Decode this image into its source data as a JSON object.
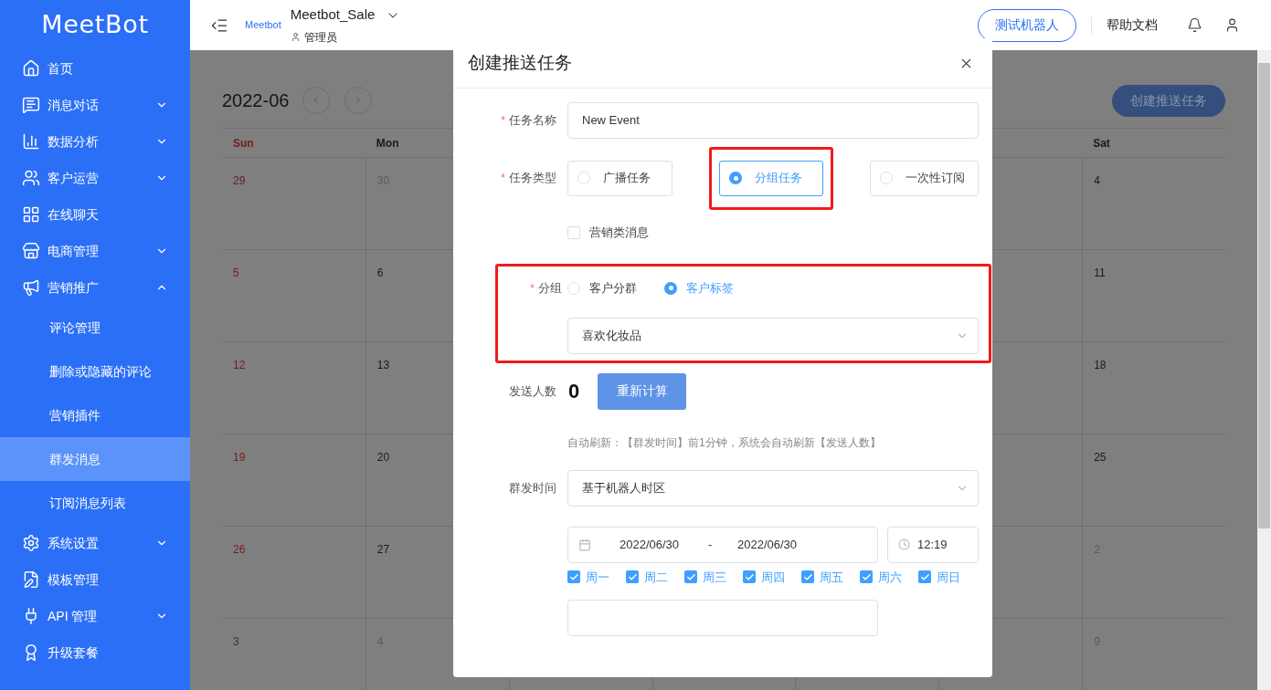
{
  "brand": "MeetBot",
  "sidebar": {
    "items": [
      {
        "label": "首页",
        "expandable": false,
        "expanded": false,
        "selected": false
      },
      {
        "label": "消息对话",
        "expandable": true,
        "expanded": false,
        "selected": false
      },
      {
        "label": "数据分析",
        "expandable": true,
        "expanded": false,
        "selected": false
      },
      {
        "label": "客户运营",
        "expandable": true,
        "expanded": false,
        "selected": false
      },
      {
        "label": "在线聊天",
        "expandable": false,
        "expanded": false,
        "selected": false
      },
      {
        "label": "电商管理",
        "expandable": true,
        "expanded": false,
        "selected": false
      },
      {
        "label": "营销推广",
        "expandable": true,
        "expanded": true,
        "selected": false,
        "children": [
          {
            "label": "评论管理",
            "selected": false
          },
          {
            "label": "删除或隐藏的评论",
            "selected": false
          },
          {
            "label": "营销插件",
            "selected": false
          },
          {
            "label": "群发消息",
            "selected": true
          },
          {
            "label": "订阅消息列表",
            "selected": false
          }
        ]
      },
      {
        "label": "系统设置",
        "expandable": true,
        "expanded": false,
        "selected": false
      },
      {
        "label": "模板管理",
        "expandable": false,
        "expanded": false,
        "selected": false
      },
      {
        "label": "API 管理",
        "expandable": true,
        "expanded": false,
        "selected": false
      },
      {
        "label": "升级套餐",
        "expandable": false,
        "expanded": false,
        "selected": false
      }
    ]
  },
  "header": {
    "logo": "Meetbot",
    "bot_name": "Meetbot_Sale",
    "role": "管理员",
    "test_button": "测试机器人",
    "help_link": "帮助文档"
  },
  "calendar": {
    "month": "2022-06",
    "create_button": "创建推送任务",
    "columns": [
      {
        "day": "Sun",
        "holiday": true,
        "dates": [
          {
            "text": "29",
            "muted": true
          },
          {
            "text": "5",
            "muted": false
          },
          {
            "text": "12",
            "muted": false
          },
          {
            "text": "19",
            "muted": false
          },
          {
            "text": "26",
            "muted": false
          },
          {
            "text": "3",
            "muted": true
          }
        ]
      },
      {
        "day": "Mon",
        "holiday": false,
        "dates": [
          {
            "text": "30",
            "muted": true
          },
          {
            "text": "6",
            "muted": false
          },
          {
            "text": "13",
            "muted": false
          },
          {
            "text": "20",
            "muted": false
          },
          {
            "text": "27",
            "muted": false
          },
          {
            "text": "4",
            "muted": true
          }
        ]
      },
      {
        "day": "Sat",
        "holiday": false,
        "dates": [
          {
            "text": "4",
            "muted": false
          },
          {
            "text": "11",
            "muted": false
          },
          {
            "text": "18",
            "muted": false
          },
          {
            "text": "25",
            "muted": false
          },
          {
            "text": "2",
            "muted": true
          },
          {
            "text": "9",
            "muted": true
          }
        ]
      }
    ]
  },
  "dialog": {
    "title": "创建推送任务",
    "task_name": {
      "label": "任务名称",
      "required_mark": "*",
      "value": "New Event"
    },
    "task_type": {
      "label": "任务类型",
      "required_mark": "*",
      "options": [
        {
          "label": "广播任务",
          "selected": false,
          "highlighted": false
        },
        {
          "label": "分组任务",
          "selected": true,
          "highlighted": true
        },
        {
          "label": "一次性订阅",
          "selected": false,
          "highlighted": false
        }
      ]
    },
    "marketing": {
      "label": "营销类消息",
      "checked": false
    },
    "group": {
      "label": "分组",
      "required_mark": "*",
      "highlighted": true,
      "options": [
        {
          "label": "客户分群",
          "selected": false
        },
        {
          "label": "客户标签",
          "selected": true
        }
      ],
      "select_value": "喜欢化妆品"
    },
    "recipients": {
      "label": "发送人数",
      "count": "0",
      "button": "重新计算"
    },
    "hint": "自动刷新：【群发时间】前1分钟，系统会自动刷新【发送人数】",
    "send_time": {
      "label": "群发时间",
      "value": "基于机器人时区",
      "start_date": "2022/06/30",
      "separator": "-",
      "end_date": "2022/06/30",
      "time": "12:19",
      "weekdays": [
        {
          "label": "周一",
          "checked": true
        },
        {
          "label": "周二",
          "checked": true
        },
        {
          "label": "周三",
          "checked": true
        },
        {
          "label": "周四",
          "checked": true
        },
        {
          "label": "周五",
          "checked": true
        },
        {
          "label": "周六",
          "checked": true
        },
        {
          "label": "周日",
          "checked": true
        }
      ]
    }
  }
}
